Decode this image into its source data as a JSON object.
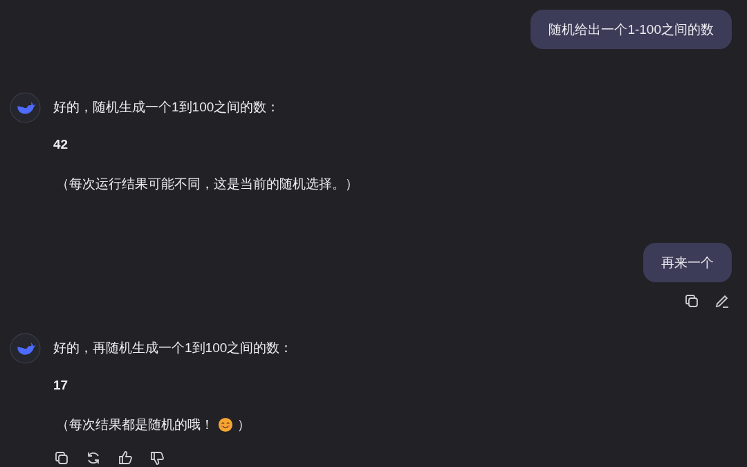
{
  "messages": [
    {
      "kind": "user",
      "text": "随机给出一个1-100之间的数"
    },
    {
      "kind": "assistant",
      "intro": "好的，随机生成一个1到100之间的数：",
      "number": "42",
      "note": "（每次运行结果可能不同，这是当前的随机选择。）"
    },
    {
      "kind": "user",
      "text": "再来一个",
      "actions": [
        {
          "kind": "copy"
        },
        {
          "kind": "edit"
        }
      ]
    },
    {
      "kind": "assistant",
      "intro": "好的，再随机生成一个1到100之间的数：",
      "number": "17",
      "note": "（每次结果都是随机的哦！",
      "note_end": "）",
      "actions": [
        {
          "kind": "copy"
        },
        {
          "kind": "regenerate"
        },
        {
          "kind": "like"
        },
        {
          "kind": "dislike"
        }
      ]
    }
  ]
}
